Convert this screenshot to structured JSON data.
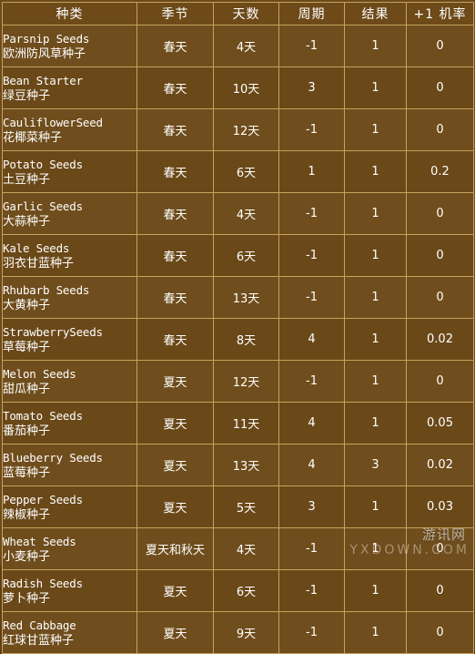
{
  "table": {
    "headers": [
      "种类",
      "季节",
      "天数",
      "周期",
      "结果",
      "+1 机率"
    ],
    "rows": [
      {
        "en": "Parsnip Seeds",
        "zh": "欧洲防风草种子",
        "season": "春天",
        "days": "4天",
        "cycle": "-1",
        "yield": "1",
        "chance": "0"
      },
      {
        "en": "Bean Starter",
        "zh": "绿豆种子",
        "season": "春天",
        "days": "10天",
        "cycle": "3",
        "yield": "1",
        "chance": "0"
      },
      {
        "en": "CauliflowerSeed",
        "zh": "花椰菜种子",
        "season": "春天",
        "days": "12天",
        "cycle": "-1",
        "yield": "1",
        "chance": "0"
      },
      {
        "en": "Potato Seeds",
        "zh": "土豆种子",
        "season": "春天",
        "days": "6天",
        "cycle": "1",
        "yield": "1",
        "chance": "0.2"
      },
      {
        "en": "Garlic Seeds",
        "zh": "大蒜种子",
        "season": "春天",
        "days": "4天",
        "cycle": "-1",
        "yield": "1",
        "chance": "0"
      },
      {
        "en": "Kale Seeds",
        "zh": "羽衣甘蓝种子",
        "season": "春天",
        "days": "6天",
        "cycle": "-1",
        "yield": "1",
        "chance": "0"
      },
      {
        "en": "Rhubarb Seeds",
        "zh": "大黄种子",
        "season": "春天",
        "days": "13天",
        "cycle": "-1",
        "yield": "1",
        "chance": "0"
      },
      {
        "en": "StrawberrySeeds",
        "zh": "草莓种子",
        "season": "春天",
        "days": "8天",
        "cycle": "4",
        "yield": "1",
        "chance": "0.02"
      },
      {
        "en": "Melon Seeds",
        "zh": "甜瓜种子",
        "season": "夏天",
        "days": "12天",
        "cycle": "-1",
        "yield": "1",
        "chance": "0"
      },
      {
        "en": "Tomato Seeds",
        "zh": "番茄种子",
        "season": "夏天",
        "days": "11天",
        "cycle": "4",
        "yield": "1",
        "chance": "0.05"
      },
      {
        "en": "Blueberry Seeds",
        "zh": "蓝莓种子",
        "season": "夏天",
        "days": "13天",
        "cycle": "4",
        "yield": "3",
        "chance": "0.02"
      },
      {
        "en": "Pepper Seeds",
        "zh": "辣椒种子",
        "season": "夏天",
        "days": "5天",
        "cycle": "3",
        "yield": "1",
        "chance": "0.03"
      },
      {
        "en": "Wheat Seeds",
        "zh": "小麦种子",
        "season": "夏天和秋天",
        "days": "4天",
        "cycle": "-1",
        "yield": "1",
        "chance": "0"
      },
      {
        "en": "Radish Seeds",
        "zh": "萝卜种子",
        "season": "夏天",
        "days": "6天",
        "cycle": "-1",
        "yield": "1",
        "chance": "0"
      },
      {
        "en": "Red Cabbage",
        "zh": "红球甘蓝种子",
        "season": "夏天",
        "days": "9天",
        "cycle": "-1",
        "yield": "1",
        "chance": "0"
      }
    ]
  },
  "watermark": {
    "main": "游讯网",
    "sub": "YXDOWN.COM"
  }
}
